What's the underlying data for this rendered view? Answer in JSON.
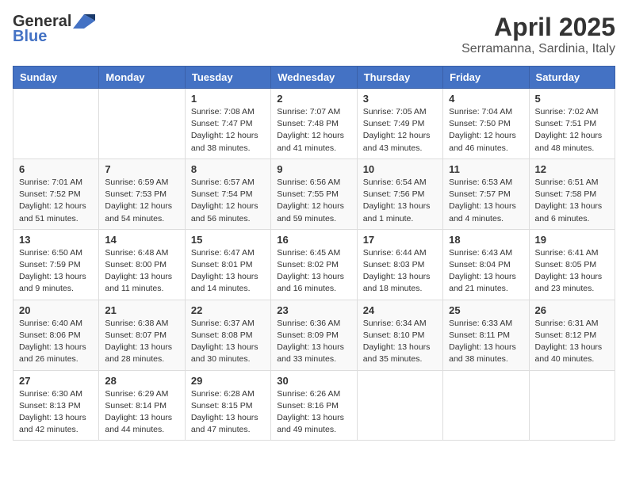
{
  "header": {
    "logo_general": "General",
    "logo_blue": "Blue",
    "month_title": "April 2025",
    "subtitle": "Serramanna, Sardinia, Italy"
  },
  "weekdays": [
    "Sunday",
    "Monday",
    "Tuesday",
    "Wednesday",
    "Thursday",
    "Friday",
    "Saturday"
  ],
  "weeks": [
    [
      {
        "day": "",
        "info": ""
      },
      {
        "day": "",
        "info": ""
      },
      {
        "day": "1",
        "info": "Sunrise: 7:08 AM\nSunset: 7:47 PM\nDaylight: 12 hours and 38 minutes."
      },
      {
        "day": "2",
        "info": "Sunrise: 7:07 AM\nSunset: 7:48 PM\nDaylight: 12 hours and 41 minutes."
      },
      {
        "day": "3",
        "info": "Sunrise: 7:05 AM\nSunset: 7:49 PM\nDaylight: 12 hours and 43 minutes."
      },
      {
        "day": "4",
        "info": "Sunrise: 7:04 AM\nSunset: 7:50 PM\nDaylight: 12 hours and 46 minutes."
      },
      {
        "day": "5",
        "info": "Sunrise: 7:02 AM\nSunset: 7:51 PM\nDaylight: 12 hours and 48 minutes."
      }
    ],
    [
      {
        "day": "6",
        "info": "Sunrise: 7:01 AM\nSunset: 7:52 PM\nDaylight: 12 hours and 51 minutes."
      },
      {
        "day": "7",
        "info": "Sunrise: 6:59 AM\nSunset: 7:53 PM\nDaylight: 12 hours and 54 minutes."
      },
      {
        "day": "8",
        "info": "Sunrise: 6:57 AM\nSunset: 7:54 PM\nDaylight: 12 hours and 56 minutes."
      },
      {
        "day": "9",
        "info": "Sunrise: 6:56 AM\nSunset: 7:55 PM\nDaylight: 12 hours and 59 minutes."
      },
      {
        "day": "10",
        "info": "Sunrise: 6:54 AM\nSunset: 7:56 PM\nDaylight: 13 hours and 1 minute."
      },
      {
        "day": "11",
        "info": "Sunrise: 6:53 AM\nSunset: 7:57 PM\nDaylight: 13 hours and 4 minutes."
      },
      {
        "day": "12",
        "info": "Sunrise: 6:51 AM\nSunset: 7:58 PM\nDaylight: 13 hours and 6 minutes."
      }
    ],
    [
      {
        "day": "13",
        "info": "Sunrise: 6:50 AM\nSunset: 7:59 PM\nDaylight: 13 hours and 9 minutes."
      },
      {
        "day": "14",
        "info": "Sunrise: 6:48 AM\nSunset: 8:00 PM\nDaylight: 13 hours and 11 minutes."
      },
      {
        "day": "15",
        "info": "Sunrise: 6:47 AM\nSunset: 8:01 PM\nDaylight: 13 hours and 14 minutes."
      },
      {
        "day": "16",
        "info": "Sunrise: 6:45 AM\nSunset: 8:02 PM\nDaylight: 13 hours and 16 minutes."
      },
      {
        "day": "17",
        "info": "Sunrise: 6:44 AM\nSunset: 8:03 PM\nDaylight: 13 hours and 18 minutes."
      },
      {
        "day": "18",
        "info": "Sunrise: 6:43 AM\nSunset: 8:04 PM\nDaylight: 13 hours and 21 minutes."
      },
      {
        "day": "19",
        "info": "Sunrise: 6:41 AM\nSunset: 8:05 PM\nDaylight: 13 hours and 23 minutes."
      }
    ],
    [
      {
        "day": "20",
        "info": "Sunrise: 6:40 AM\nSunset: 8:06 PM\nDaylight: 13 hours and 26 minutes."
      },
      {
        "day": "21",
        "info": "Sunrise: 6:38 AM\nSunset: 8:07 PM\nDaylight: 13 hours and 28 minutes."
      },
      {
        "day": "22",
        "info": "Sunrise: 6:37 AM\nSunset: 8:08 PM\nDaylight: 13 hours and 30 minutes."
      },
      {
        "day": "23",
        "info": "Sunrise: 6:36 AM\nSunset: 8:09 PM\nDaylight: 13 hours and 33 minutes."
      },
      {
        "day": "24",
        "info": "Sunrise: 6:34 AM\nSunset: 8:10 PM\nDaylight: 13 hours and 35 minutes."
      },
      {
        "day": "25",
        "info": "Sunrise: 6:33 AM\nSunset: 8:11 PM\nDaylight: 13 hours and 38 minutes."
      },
      {
        "day": "26",
        "info": "Sunrise: 6:31 AM\nSunset: 8:12 PM\nDaylight: 13 hours and 40 minutes."
      }
    ],
    [
      {
        "day": "27",
        "info": "Sunrise: 6:30 AM\nSunset: 8:13 PM\nDaylight: 13 hours and 42 minutes."
      },
      {
        "day": "28",
        "info": "Sunrise: 6:29 AM\nSunset: 8:14 PM\nDaylight: 13 hours and 44 minutes."
      },
      {
        "day": "29",
        "info": "Sunrise: 6:28 AM\nSunset: 8:15 PM\nDaylight: 13 hours and 47 minutes."
      },
      {
        "day": "30",
        "info": "Sunrise: 6:26 AM\nSunset: 8:16 PM\nDaylight: 13 hours and 49 minutes."
      },
      {
        "day": "",
        "info": ""
      },
      {
        "day": "",
        "info": ""
      },
      {
        "day": "",
        "info": ""
      }
    ]
  ]
}
